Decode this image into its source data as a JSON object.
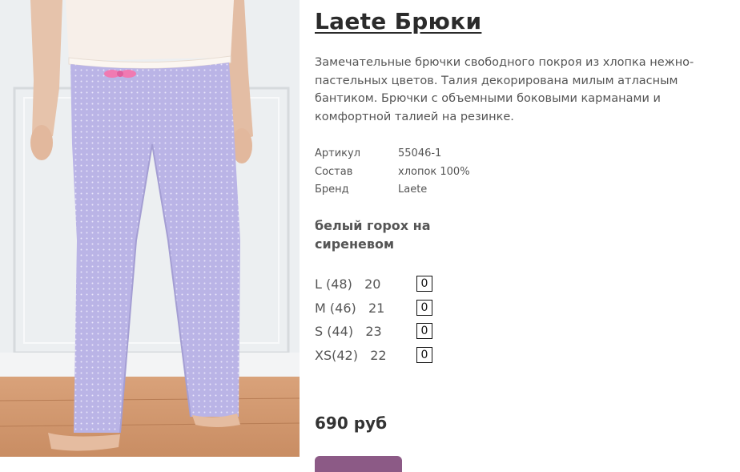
{
  "product": {
    "title": "Laete Брюки",
    "description": "Замечательные брючки свободного покроя из хлопка нежно-пастельных цветов. Талия декорирована милым атласным бантиком. Брючки с объемными боковыми карманами и комфортной талией на резинке.",
    "specs": [
      {
        "key": "Артикул",
        "value": "55046-1"
      },
      {
        "key": "Состав",
        "value": "хлопок 100%"
      },
      {
        "key": "Бренд",
        "value": "Laete"
      }
    ],
    "color_name": "белый горох на сиреневом",
    "sizes": [
      {
        "label": "L (48)   20",
        "qty": "0"
      },
      {
        "label": "M (46)   21",
        "qty": "0"
      },
      {
        "label": "S (44)   23",
        "qty": "0"
      },
      {
        "label": "XS(42)   22",
        "qty": "0"
      }
    ],
    "price": "690 руб"
  },
  "colors": {
    "pants": "#b9b3e6",
    "button": "#8c5a86",
    "title": "#2b2b2b",
    "text": "#555555"
  }
}
